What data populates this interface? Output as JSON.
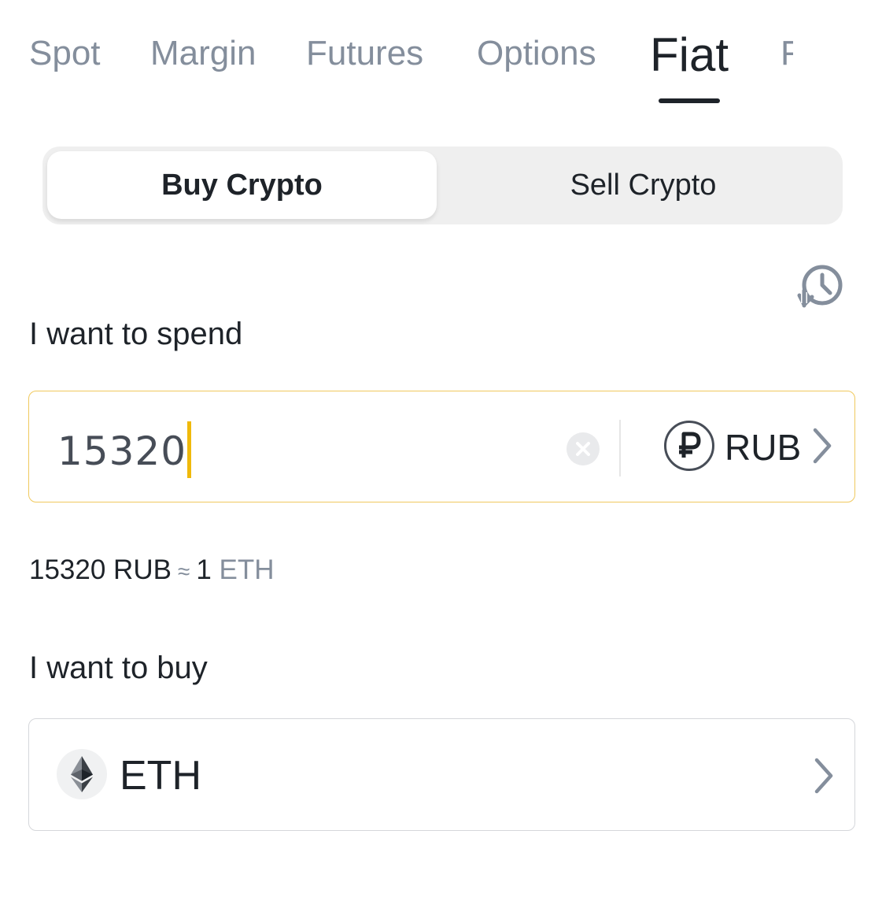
{
  "tabs": [
    {
      "label": "Spot",
      "active": false
    },
    {
      "label": "Margin",
      "active": false
    },
    {
      "label": "Futures",
      "active": false
    },
    {
      "label": "Options",
      "active": false
    },
    {
      "label": "Fiat",
      "active": true
    },
    {
      "label": "F",
      "active": false
    }
  ],
  "segment": {
    "buy_label": "Buy Crypto",
    "sell_label": "Sell Crypto",
    "selected": "Buy Crypto"
  },
  "spend": {
    "label": "I want to spend",
    "value": "15320",
    "currency": "RUB",
    "currency_icon": "ruble-icon"
  },
  "rate": {
    "fiat_amount": "15320 RUB",
    "approx": "≈",
    "crypto_amount": "1",
    "crypto_unit": "ETH"
  },
  "buy": {
    "label": "I want to buy",
    "asset": "ETH",
    "asset_icon": "ethereum-icon"
  },
  "colors": {
    "accent": "#f0b90b",
    "text_primary": "#1e2329",
    "text_secondary": "#848e9c",
    "input_border_focus": "#f0c95e",
    "input_border": "#d5d7db"
  }
}
